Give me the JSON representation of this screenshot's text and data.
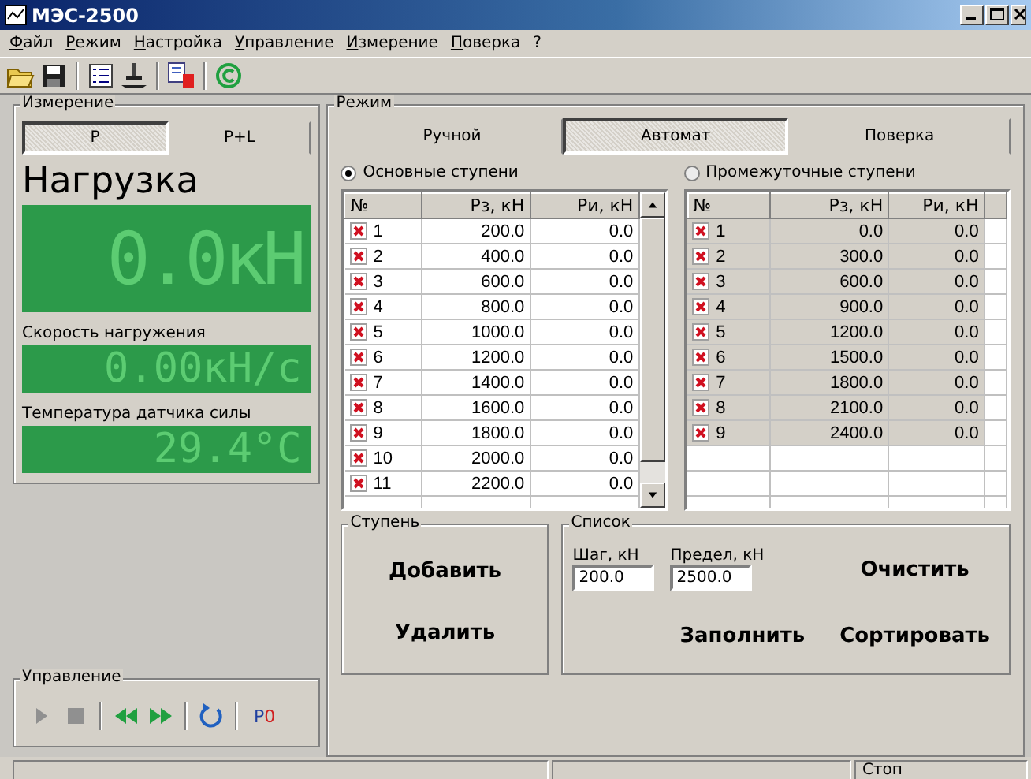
{
  "window": {
    "title": "МЭС-2500"
  },
  "menu": [
    "Файл",
    "Режим",
    "Настройка",
    "Управление",
    "Измерение",
    "Поверка",
    "?"
  ],
  "toolbar": [
    {
      "kind": "open"
    },
    {
      "kind": "save"
    },
    {
      "kind": "sep"
    },
    {
      "kind": "list"
    },
    {
      "kind": "weight"
    },
    {
      "kind": "sep"
    },
    {
      "kind": "report"
    },
    {
      "kind": "sep"
    },
    {
      "kind": "copyright"
    }
  ],
  "measurement": {
    "title": "Измерение",
    "tabs": [
      {
        "label": "P",
        "selected": true
      },
      {
        "label": "P+L",
        "selected": false
      }
    ],
    "load_label": "Нагрузка",
    "load_value": "0.0кН",
    "displays": [
      {
        "label": "Скорость нагружения",
        "value": "0.00кН/с"
      },
      {
        "label": "Температура датчика силы",
        "value": "29.4°С"
      }
    ]
  },
  "control": {
    "title": "Управление",
    "buttons": [
      {
        "kind": "play"
      },
      {
        "kind": "stop"
      },
      {
        "kind": "sep"
      },
      {
        "kind": "rewind"
      },
      {
        "kind": "forward"
      },
      {
        "kind": "sep"
      },
      {
        "kind": "refresh"
      },
      {
        "kind": "sep"
      },
      {
        "kind": "reset",
        "parts": [
          "P",
          "0"
        ]
      }
    ]
  },
  "mode": {
    "title": "Режим",
    "tabs": [
      {
        "label": "Ручной",
        "selected": false
      },
      {
        "label": "Автомат",
        "selected": true
      },
      {
        "label": "Поверка",
        "selected": false
      }
    ],
    "tables": [
      {
        "radio": "Основные ступени",
        "selected": true,
        "columns": [
          "№",
          "Рз, кН",
          "Ри, кН"
        ],
        "rows": [
          {
            "n": "1",
            "p_set": "200.0",
            "p_meas": "0.0",
            "checked": true
          },
          {
            "n": "2",
            "p_set": "400.0",
            "p_meas": "0.0",
            "checked": true
          },
          {
            "n": "3",
            "p_set": "600.0",
            "p_meas": "0.0",
            "checked": true
          },
          {
            "n": "4",
            "p_set": "800.0",
            "p_meas": "0.0",
            "checked": true
          },
          {
            "n": "5",
            "p_set": "1000.0",
            "p_meas": "0.0",
            "checked": true
          },
          {
            "n": "6",
            "p_set": "1200.0",
            "p_meas": "0.0",
            "checked": true
          },
          {
            "n": "7",
            "p_set": "1400.0",
            "p_meas": "0.0",
            "checked": true
          },
          {
            "n": "8",
            "p_set": "1600.0",
            "p_meas": "0.0",
            "checked": true
          },
          {
            "n": "9",
            "p_set": "1800.0",
            "p_meas": "0.0",
            "checked": true
          },
          {
            "n": "10",
            "p_set": "2000.0",
            "p_meas": "0.0",
            "checked": true
          },
          {
            "n": "11",
            "p_set": "2200.0",
            "p_meas": "0.0",
            "checked": true
          }
        ]
      },
      {
        "radio": "Промежуточные ступени",
        "selected": false,
        "columns": [
          "№",
          "Рз, кН",
          "Ри, кН"
        ],
        "rows": [
          {
            "n": "1",
            "p_set": "0.0",
            "p_meas": "0.0",
            "checked": true
          },
          {
            "n": "2",
            "p_set": "300.0",
            "p_meas": "0.0",
            "checked": true
          },
          {
            "n": "3",
            "p_set": "600.0",
            "p_meas": "0.0",
            "checked": true
          },
          {
            "n": "4",
            "p_set": "900.0",
            "p_meas": "0.0",
            "checked": true
          },
          {
            "n": "5",
            "p_set": "1200.0",
            "p_meas": "0.0",
            "checked": true
          },
          {
            "n": "6",
            "p_set": "1500.0",
            "p_meas": "0.0",
            "checked": true
          },
          {
            "n": "7",
            "p_set": "1800.0",
            "p_meas": "0.0",
            "checked": true
          },
          {
            "n": "8",
            "p_set": "2100.0",
            "p_meas": "0.0",
            "checked": true
          },
          {
            "n": "9",
            "p_set": "2400.0",
            "p_meas": "0.0",
            "checked": true
          }
        ]
      }
    ],
    "step": {
      "title": "Ступень",
      "add": "Добавить",
      "remove": "Удалить"
    },
    "list": {
      "title": "Список",
      "step_label": "Шаг, кН",
      "step_value": "200.0",
      "limit_label": "Предел, кН",
      "limit_value": "2500.0",
      "clear": "Очистить",
      "fill": "Заполнить",
      "sort": "Сортировать"
    }
  },
  "status_bar": [
    "Стоп"
  ]
}
